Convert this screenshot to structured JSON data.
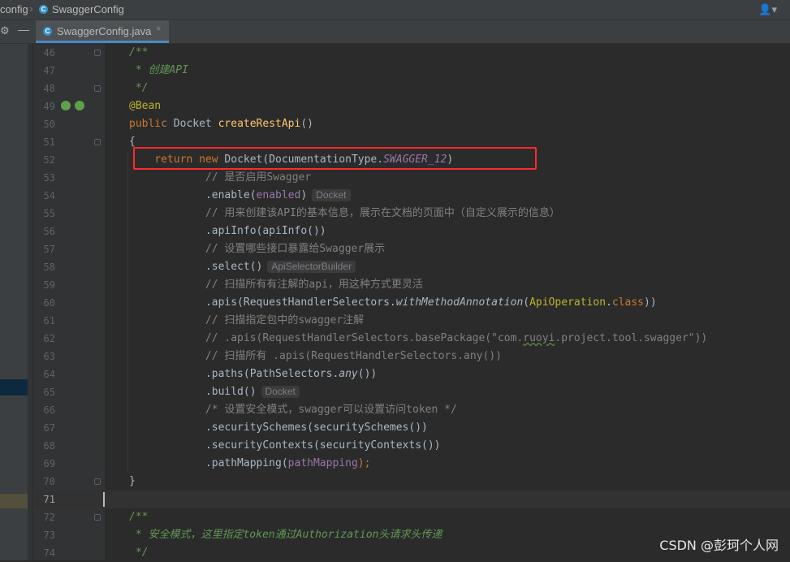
{
  "breadcrumb": {
    "parent": "config",
    "current": "SwaggerConfig"
  },
  "tab": {
    "filename": "SwaggerConfig.java",
    "close": "×"
  },
  "icons": {
    "class_icon": "C",
    "user": "user-icon",
    "gear": "gear-icon",
    "minimize": "minimize-icon"
  },
  "colors": {
    "highlight": "#ff2a2a",
    "keyword": "#cc7832",
    "comment": "#808080",
    "doc": "#629755",
    "annotation": "#bbb529",
    "method": "#ffc66d",
    "field": "#9876aa"
  },
  "active_line": "71",
  "hints": {
    "enable": "Docket",
    "select": "ApiSelectorBuilder",
    "build": "Docket"
  },
  "code": {
    "l46": "/**",
    "l47": " * 创建API",
    "l48": " */",
    "l49": "@Bean",
    "l50a": "public",
    "l50b": " Docket ",
    "l50c": "createRestApi",
    "l50d": "()",
    "l51": "{",
    "l52a": "    return",
    "l52b": " new",
    "l52c": " Docket(DocumentationType.",
    "l52d": "SWAGGER_12",
    "l52e": ")",
    "l53": "            // 是否启用Swagger",
    "l54a": "            .enable(",
    "l54b": "enabled",
    "l54c": ")",
    "l55": "            // 用来创建该API的基本信息，展示在文档的页面中（自定义展示的信息）",
    "l56": "            .apiInfo(apiInfo())",
    "l57": "            // 设置哪些接口暴露给Swagger展示",
    "l58": "            .select()",
    "l59": "            // 扫描所有有注解的api，用这种方式更灵活",
    "l60a": "            .apis(RequestHandlerSelectors.",
    "l60b": "withMethodAnnotation",
    "l60c": "(",
    "l60d": "ApiOperation",
    "l60e": ".",
    "l60f": "class",
    "l60g": "))",
    "l61": "            // 扫描指定包中的swagger注解",
    "l62a": "            // .apis(RequestHandlerSelectors.basePackage(\"com.",
    "l62b": "ruoyi",
    "l62c": ".project.tool.swagger\"))",
    "l63": "            // 扫描所有 .apis(RequestHandlerSelectors.any())",
    "l64a": "            .paths(PathSelectors.",
    "l64b": "any",
    "l64c": "())",
    "l65": "            .build()",
    "l66": "            /* 设置安全模式，swagger可以设置访问token */",
    "l67": "            .securitySchemes(securitySchemes())",
    "l68": "            .securityContexts(securityContexts())",
    "l69a": "            .pathMapping(",
    "l69b": "pathMapping",
    "l69c": ");",
    "l70": "}",
    "l72": "/**",
    "l73": " * 安全模式，这里指定token通过Authorization头请求头传递",
    "l74": " */"
  },
  "line_numbers": [
    "46",
    "47",
    "48",
    "49",
    "50",
    "51",
    "52",
    "53",
    "54",
    "55",
    "56",
    "57",
    "58",
    "59",
    "60",
    "61",
    "62",
    "63",
    "64",
    "65",
    "66",
    "67",
    "68",
    "69",
    "70",
    "71",
    "72",
    "73",
    "74"
  ],
  "watermark": "CSDN @彭珂个人网"
}
